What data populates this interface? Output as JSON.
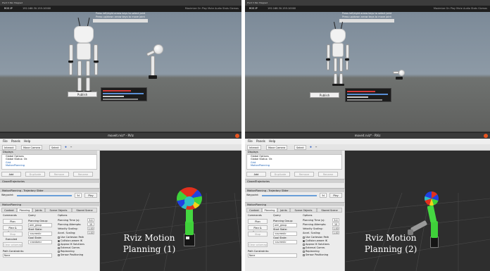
{
  "panels": [
    {
      "unity": {
        "top_menu": "Pivot  ▾  Pan Mapped",
        "ros_label": "ROS IP",
        "ros_ip": "192.168.30.155:10000",
        "hint_line1": "Press left/right arrow keys to select joint",
        "hint_line2": "Press up/down arrow keys to move joint",
        "stats": "Maximize On Play  Mute Audio  Stats  Gizmos",
        "publish_label": "Publish"
      },
      "rviz": {
        "title": "moveit.rviz* - RViz",
        "menu": [
          "File",
          "Panels",
          "Help"
        ],
        "tools": [
          "Interact",
          "Move Camera",
          "Select"
        ],
        "displays_header": "Displays",
        "display_items": [
          "Global Options",
          "Global Status: Ok",
          "Grid",
          "MotionPlanning"
        ],
        "buttons": [
          "Add",
          "Duplicate",
          "Remove",
          "Rename"
        ],
        "closed_panel": "ClosedTrajectories",
        "trajectory_section": "MotionPlanning - Trajectory Slider",
        "waypoint_label": "Waypoint:",
        "waypoint_start": "34",
        "waypoint_end": "34",
        "play_label": "Play",
        "motion_section": "MotionPlanning",
        "tabs": [
          "Context",
          "Planning",
          "Joints",
          "Scene Objects",
          "Stored Scene"
        ],
        "commands_label": "Commands",
        "query_label": "Query",
        "options_label": "Options",
        "plan_label": "Plan",
        "plan_execute_label": "Plan & Execute",
        "stop_label": "Stop",
        "executed_label": "Executed",
        "clear_octomap_label": "Clear octomap",
        "planning_group_label": "Planning Group:",
        "planning_group_value": "arm_group",
        "start_state_label": "Start State:",
        "start_state_value": "<current>",
        "goal_state_label": "Goal State:",
        "goal_state_value": "<random>",
        "planning_time_label": "Planning Time (s):",
        "planning_time_value": "5.0",
        "planning_attempts_label": "Planning Attempts:",
        "planning_attempts_value": "10",
        "velocity_label": "Velocity Scaling:",
        "velocity_value": "1.00",
        "accel_label": "Accel. Scaling:",
        "accel_value": "1.00",
        "checks": [
          "Use Cartesian Path",
          "Collision-aware IK",
          "Approx IK Solutions",
          "External Comm.",
          "Replanning",
          "Sensor Positioning"
        ],
        "checks_on": [
          false,
          true,
          false,
          false,
          false,
          false
        ],
        "path_constraints_label": "Path Constraints:",
        "path_constraints_value": "None"
      },
      "caption_line1": "Rviz Motion",
      "caption_line2": "Planning (1)"
    },
    {
      "unity": {
        "top_menu": "Pivot  ▾  Pan Mapped",
        "ros_label": "ROS IP",
        "ros_ip": "192.168.30.155:10000",
        "hint_line1": "Press left/right arrow keys to select joint",
        "hint_line2": "Press up/down arrow keys to move joint",
        "stats": "Maximize On Play  Mute Audio  Stats  Gizmos",
        "publish_label": "Publish"
      },
      "rviz": {
        "title": "moveit.rviz* - RViz",
        "menu": [
          "File",
          "Panels",
          "Help"
        ],
        "tools": [
          "Interact",
          "Move Camera",
          "Select"
        ],
        "displays_header": "Displays",
        "display_items": [
          "Global Options",
          "Global Status: Ok",
          "Grid",
          "MotionPlanning"
        ],
        "buttons": [
          "Add",
          "Duplicate",
          "Remove",
          "Rename"
        ],
        "closed_panel": "ClosedTrajectories",
        "trajectory_section": "MotionPlanning - Trajectory Slider",
        "waypoint_label": "Waypoint:",
        "waypoint_start": "34",
        "waypoint_end": "34",
        "play_label": "Play",
        "motion_section": "MotionPlanning",
        "tabs": [
          "Context",
          "Planning",
          "Joints",
          "Scene Objects",
          "Stored Scene"
        ],
        "commands_label": "Commands",
        "query_label": "Query",
        "options_label": "Options",
        "plan_label": "Plan",
        "plan_execute_label": "Plan & Execute",
        "stop_label": "Stop",
        "executed_label": "Executed",
        "clear_octomap_label": "Clear octomap",
        "planning_group_label": "Planning Group:",
        "planning_group_value": "arm_group",
        "start_state_label": "Start State:",
        "start_state_value": "<current>",
        "goal_state_label": "Goal State:",
        "goal_state_value": "<current>",
        "planning_time_label": "Planning Time (s):",
        "planning_time_value": "5.0",
        "planning_attempts_label": "Planning Attempts:",
        "planning_attempts_value": "10",
        "velocity_label": "Velocity Scaling:",
        "velocity_value": "1.00",
        "accel_label": "Accel. Scaling:",
        "accel_value": "1.00",
        "checks": [
          "Use Cartesian Path",
          "Collision-aware IK",
          "Approx IK Solutions",
          "External Comm.",
          "Replanning",
          "Sensor Positioning"
        ],
        "checks_on": [
          false,
          true,
          false,
          false,
          false,
          false
        ],
        "path_constraints_label": "Path Constraints:",
        "path_constraints_value": "None"
      },
      "caption_line1": "Rviz Motion",
      "caption_line2": "Planning (2)"
    }
  ],
  "colors": {
    "robot_green": "#3fd13a",
    "robot_teal": "#2fbfc4",
    "robot_red": "#e0301e",
    "robot_blue": "#2040e0",
    "robot_yellow": "#f2d21a",
    "rviz_title_close": "#e95420",
    "slider_blue": "#6a9fd8"
  }
}
